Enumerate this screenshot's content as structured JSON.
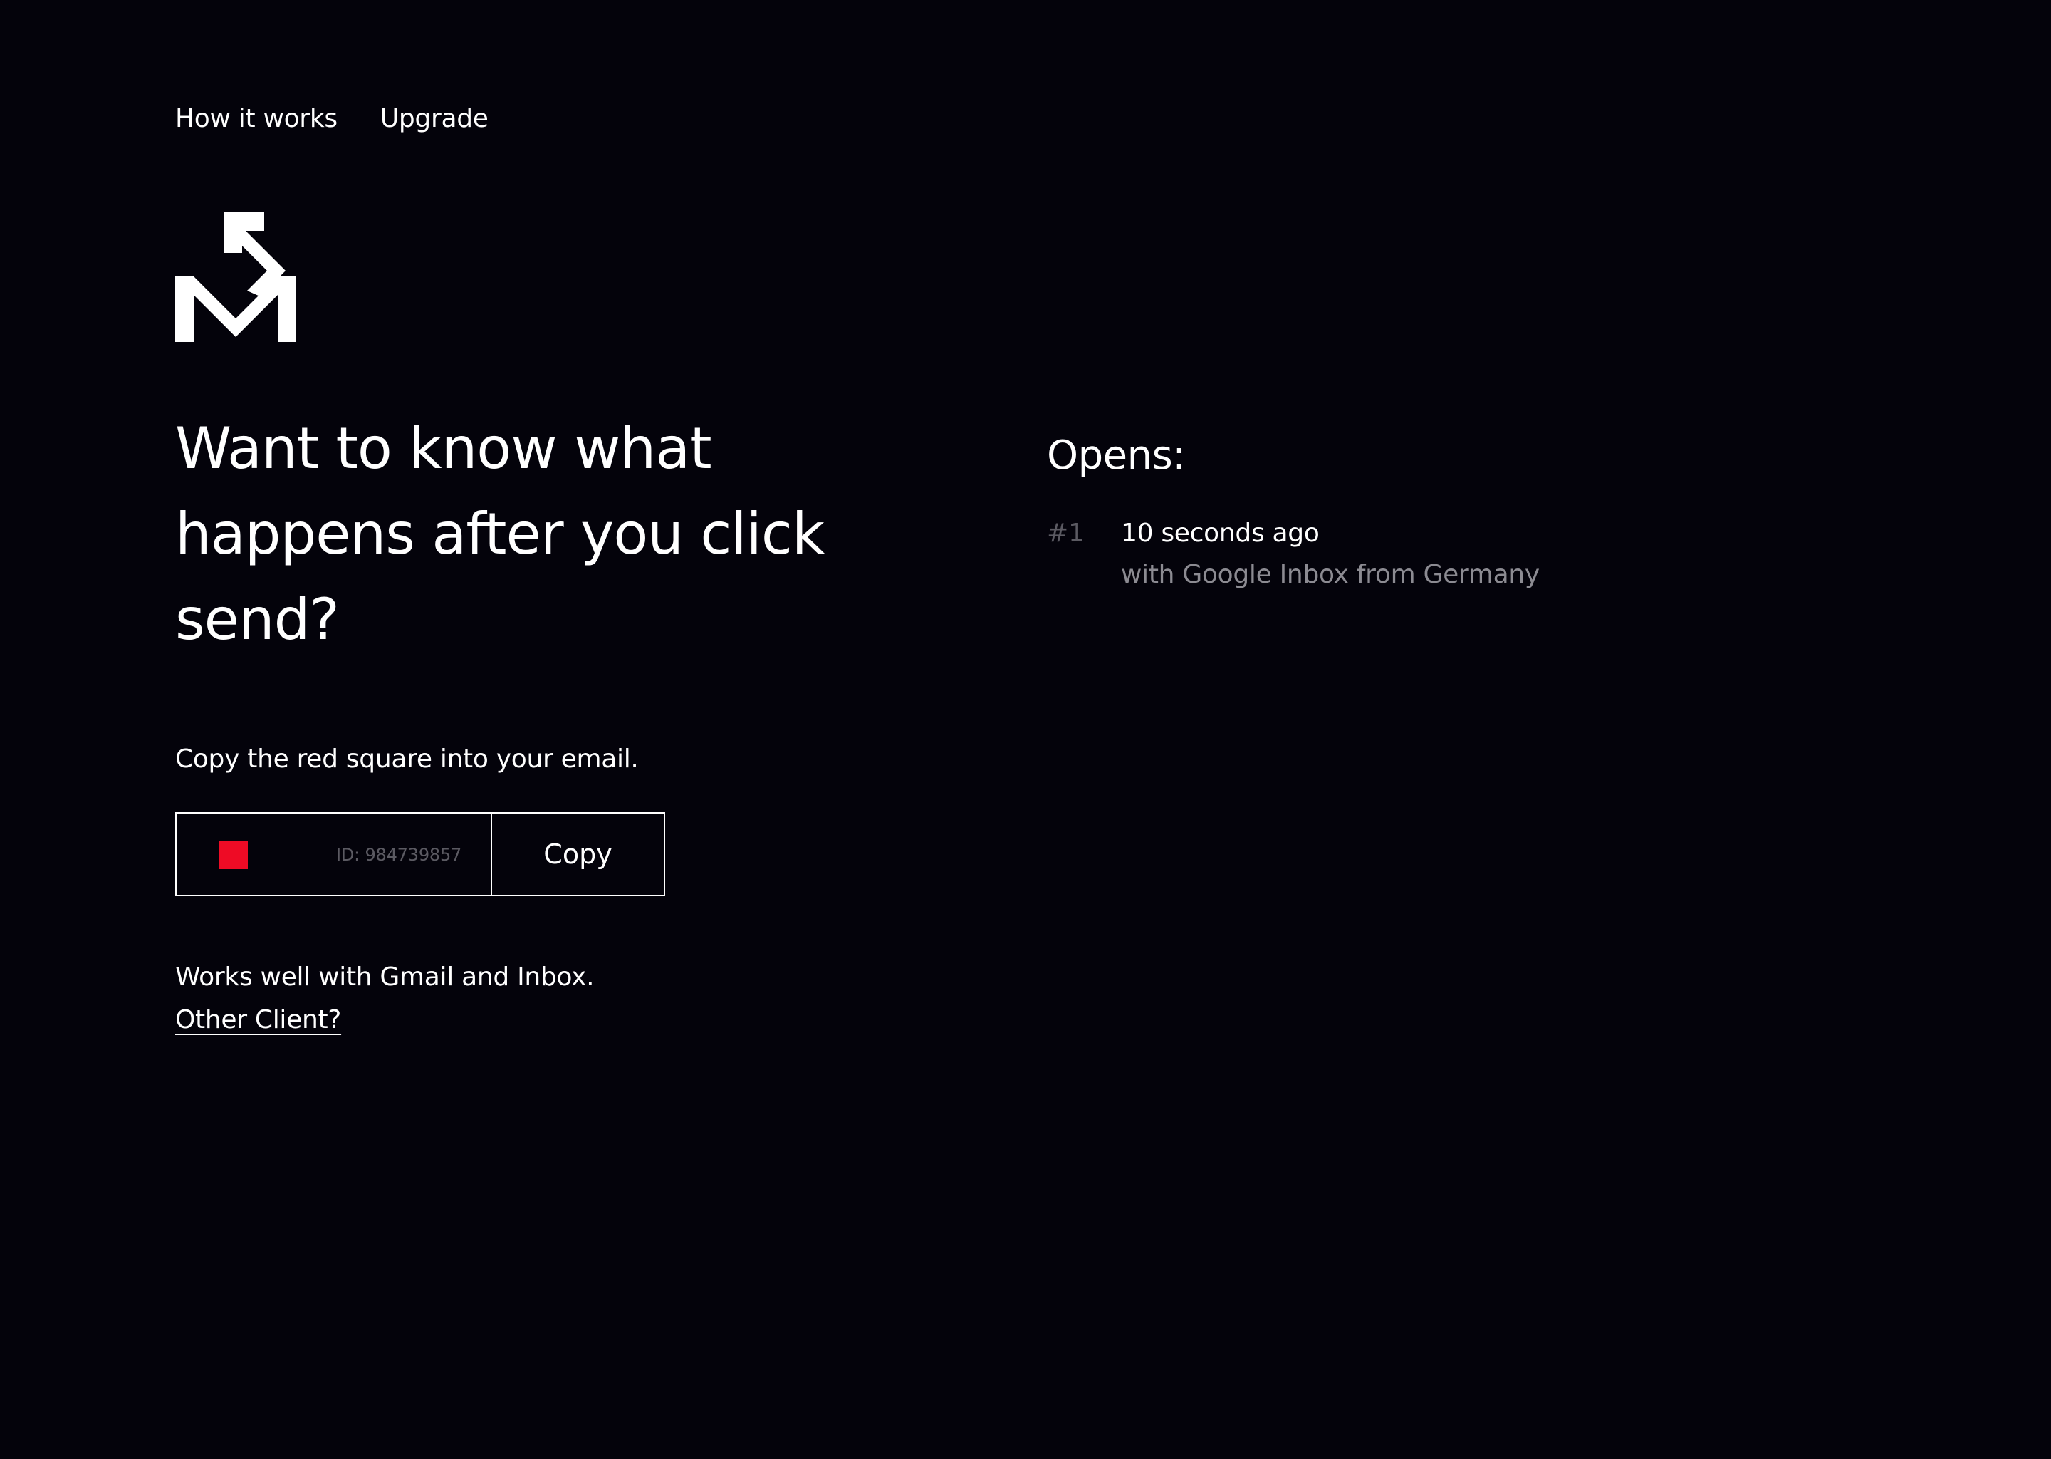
{
  "nav": {
    "how_it_works": "How it works",
    "upgrade": "Upgrade"
  },
  "logo": {
    "icon": "mail-arrow-logo-icon"
  },
  "headline": "Want to know what happens after you click send?",
  "instruction": "Copy the red square into your email.",
  "tracker": {
    "square_color": "#ee0b25",
    "id_text": "ID: 984739857",
    "copy_label": "Copy"
  },
  "compat": {
    "text": "Works well with Gmail and Inbox.",
    "link": "Other Client?"
  },
  "opens": {
    "title": "Opens:",
    "entries": [
      {
        "number": "#1",
        "time": "10 seconds ago",
        "detail": "with Google Inbox from Germany"
      }
    ]
  },
  "colors": {
    "background": "#04030b",
    "text": "#ffffff",
    "muted": "#8c8b92",
    "dim": "#5b5a62",
    "accent": "#ee0b25"
  }
}
